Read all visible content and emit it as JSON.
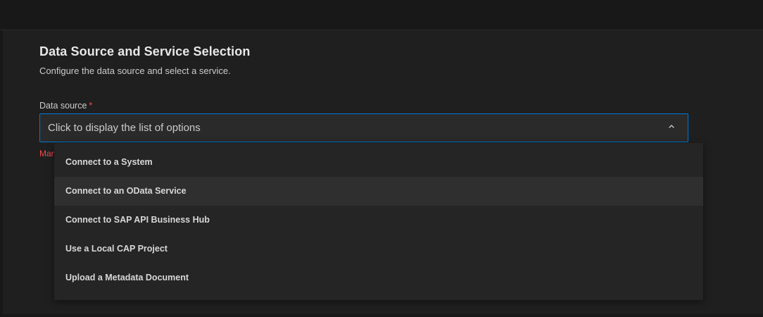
{
  "header": {
    "title": "Data Source and Service Selection",
    "subtitle": "Configure the data source and select a service."
  },
  "data_source": {
    "label": "Data source",
    "required_marker": "*",
    "placeholder": "Click to display the list of options",
    "error_fragment": "Mar",
    "chevron_icon": "chevron-up-icon",
    "expanded": true,
    "options": [
      "Connect to a System",
      "Connect to an OData Service",
      "Connect to SAP API Business Hub",
      "Use a Local CAP Project",
      "Upload a Metadata Document"
    ],
    "hovered_option_index": 1
  },
  "colors": {
    "background": "#1f1f1f",
    "focus_border": "#0078d4",
    "error": "#f14c4c",
    "dropdown_bg": "#252526",
    "hover_bg": "#2f2f2f"
  }
}
